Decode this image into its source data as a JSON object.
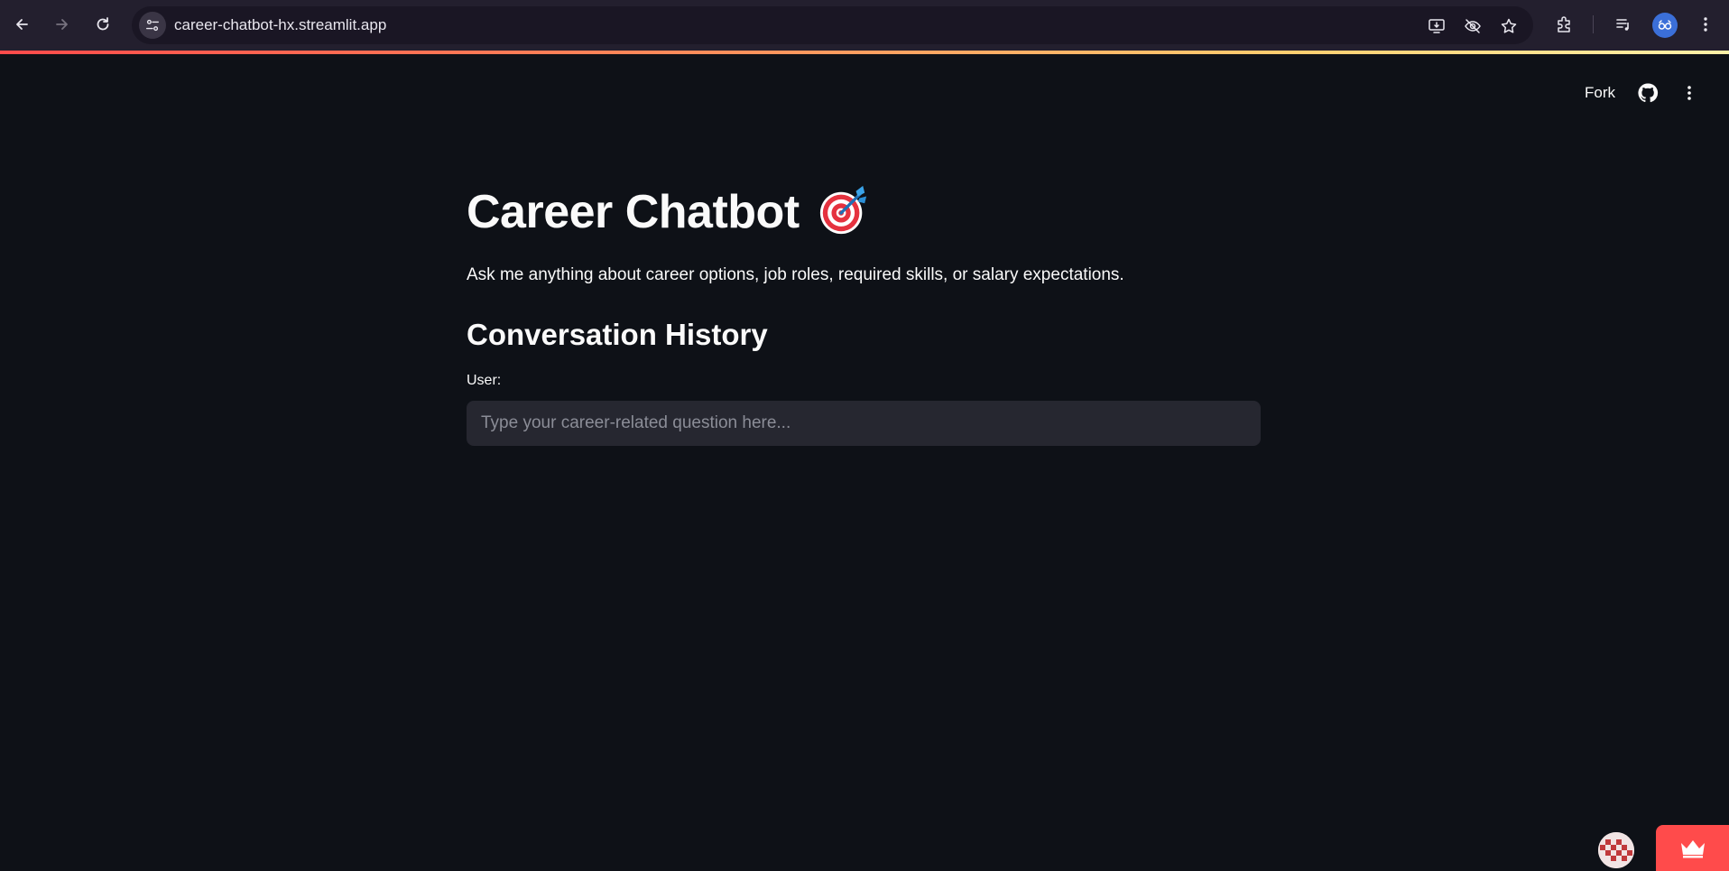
{
  "browser": {
    "url": "career-chatbot-hx.streamlit.app",
    "icons": [
      "back-arrow-icon",
      "forward-arrow-icon",
      "reload-icon",
      "site-info-icon",
      "install-app-icon",
      "eye-off-icon",
      "star-icon",
      "extensions-icon",
      "media-queue-icon",
      "profile-avatar-icon",
      "chrome-menu-icon"
    ]
  },
  "toolbar": {
    "fork_label": "Fork",
    "icons": [
      "github-icon",
      "more-vertical-icon"
    ]
  },
  "main": {
    "title": "Career Chatbot",
    "title_emoji": "direct-hit-target-icon",
    "subtitle": "Ask me anything about career options, job roles, required skills, or salary expectations.",
    "section_title": "Conversation History",
    "input_label": "User:",
    "input_placeholder": "Type your career-related question here...",
    "input_value": ""
  },
  "badges": {
    "icons": [
      "user-avatar-icon",
      "crown-icon"
    ]
  },
  "colors": {
    "background": "#0e1117",
    "input_bg": "#262730",
    "accent": "#ff4b4b",
    "chrome_bg": "#231f2e"
  }
}
